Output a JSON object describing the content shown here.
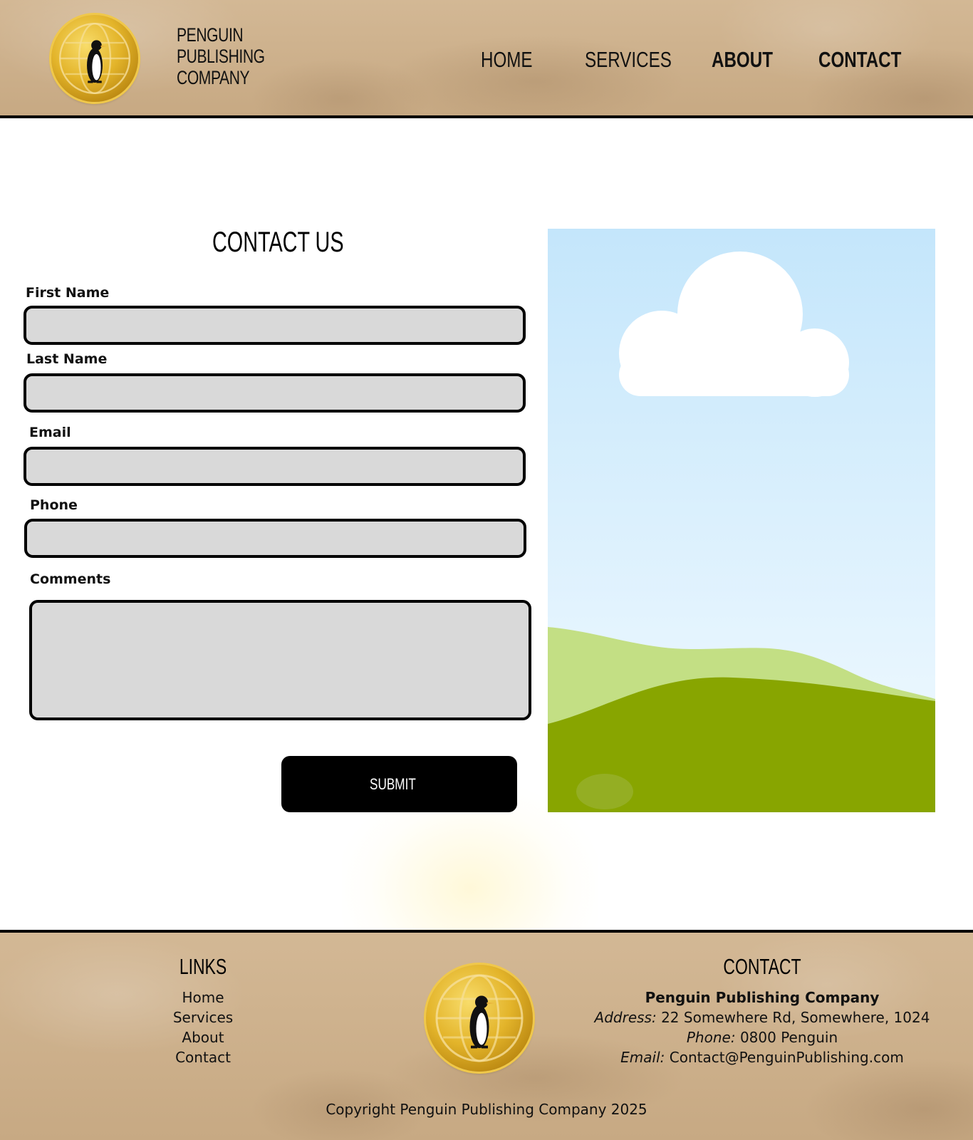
{
  "header": {
    "brand_line1": "PENGUIN",
    "brand_line2": "PUBLISHING",
    "brand_line3": "COMPANY",
    "nav": [
      "HOME",
      "SERVICES",
      "ABOUT",
      "CONTACT"
    ]
  },
  "form": {
    "title": "CONTACT US",
    "first_name_label": "First Name",
    "first_name_value": "",
    "last_name_label": "Last Name",
    "last_name_value": "",
    "email_label": "Email",
    "email_value": "",
    "phone_label": "Phone",
    "phone_value": "",
    "comments_label": "Comments",
    "comments_value": "",
    "submit_label": "SUBMIT"
  },
  "footer": {
    "links_title": "LINKS",
    "links": [
      "Home",
      "Services",
      "About",
      "Contact"
    ],
    "contact_title": "CONTACT",
    "company": "Penguin Publishing Company",
    "address_label": "Address:",
    "address_value": "22 Somewhere Rd, Somewhere, 1024",
    "phone_label": "Phone:",
    "phone_value": "0800 Penguin",
    "email_label": "Email:",
    "email_value": "Contact@PenguinPublishing.com",
    "copyright": "Copyright Penguin Publishing Company 2025"
  },
  "icons": {
    "logo": "penguin-globe-coin-icon"
  },
  "colors": {
    "paper": "#cdb08c",
    "field_bg": "#d9d9d9",
    "button_bg": "#000000",
    "sky_top": "#c4e6fb",
    "sky_bottom": "#f2faff",
    "hill_light": "#c3df84",
    "hill_dark": "#88a500"
  }
}
